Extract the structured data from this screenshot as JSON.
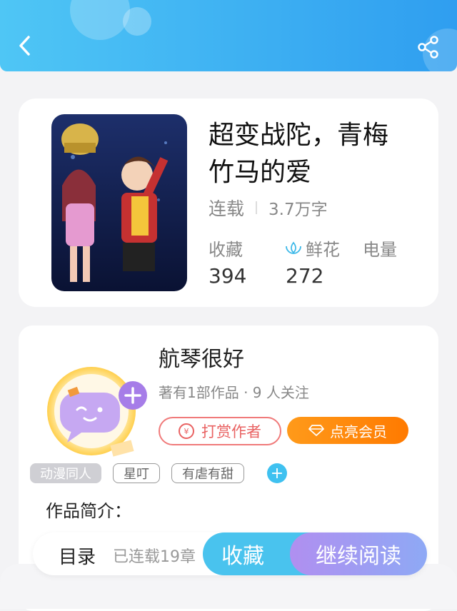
{
  "header": {
    "back_icon": "chevron-left-icon",
    "share_icon": "share-icon"
  },
  "book": {
    "title": "超变战陀，青梅竹马的爱",
    "status": "连载",
    "word_count": "3.7万字",
    "stats": {
      "favorites_label": "收藏",
      "favorites_value": "394",
      "flowers_label": "鲜花",
      "flowers_value": "272",
      "power_label": "电量"
    }
  },
  "author": {
    "name": "航琴很好",
    "meta": "著有1部作品 · 9 人关注",
    "reward_label": "打赏作者",
    "vip_label": "点亮会员"
  },
  "tags": [
    "动漫同人",
    "星叮",
    "有虐有甜"
  ],
  "intro_label": "作品简介：",
  "bottom": {
    "toc_label": "目录",
    "chapter_count": "已连载19章",
    "collect_label": "收藏",
    "read_label": "继续阅读"
  },
  "colors": {
    "header_start": "#4fc6f5",
    "header_end": "#2f9ef0",
    "vip_orange": "#ff8a00",
    "reward_red": "#e96262",
    "collect_blue": "#49c3ee",
    "read_purple": "#b08ff0"
  }
}
